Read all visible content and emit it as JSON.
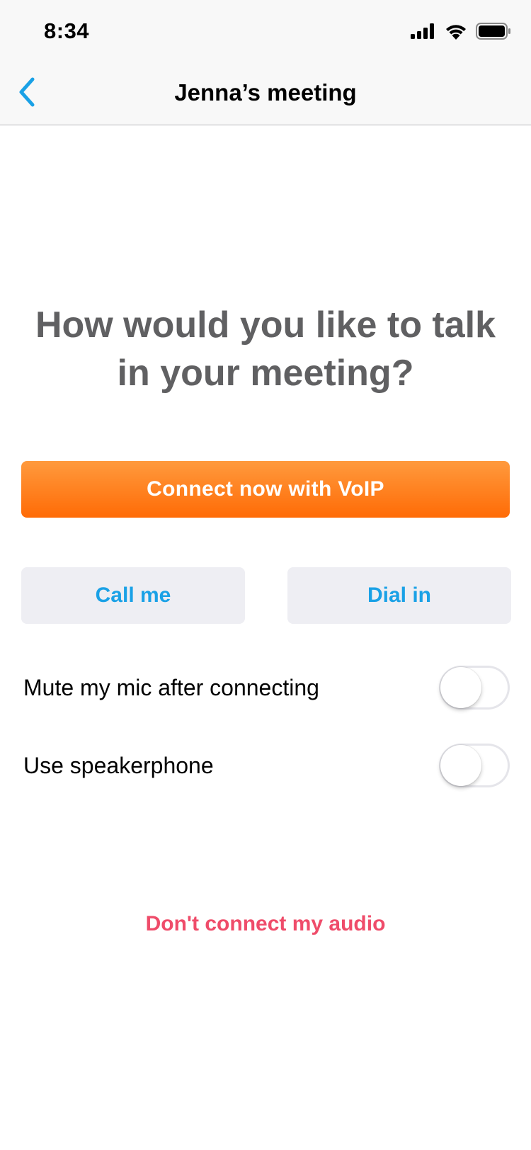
{
  "status_bar": {
    "time": "8:34",
    "icons": [
      "cellular-signal-icon",
      "wifi-icon",
      "battery-icon"
    ]
  },
  "nav": {
    "title": "Jenna’s meeting",
    "back_icon": "chevron-left-icon"
  },
  "main": {
    "headline": "How would you like to talk in your meeting?",
    "voip_button_label": "Connect now with VoIP",
    "call_me_label": "Call me",
    "dial_in_label": "Dial in",
    "toggles": [
      {
        "label": "Mute my mic after connecting",
        "on": false
      },
      {
        "label": "Use speakerphone",
        "on": false
      }
    ],
    "dont_connect_label": "Don't connect my audio"
  },
  "colors": {
    "accent_blue": "#1aa1e6",
    "voip_orange_top": "#ff9a3d",
    "voip_orange_bottom": "#ff6b06",
    "destructive_red": "#ef4c6a",
    "headline_gray": "#606062"
  }
}
